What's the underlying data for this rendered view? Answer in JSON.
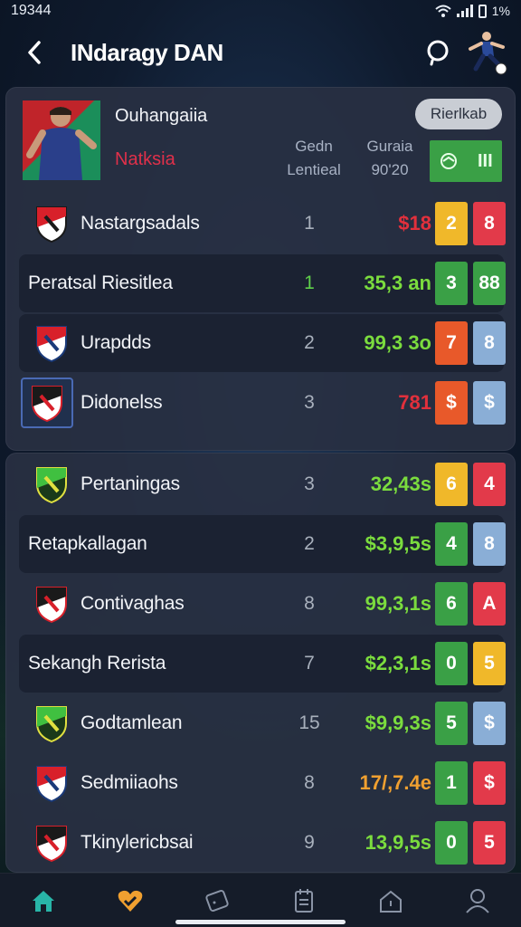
{
  "status_bar": {
    "time": "19344",
    "battery": "1%"
  },
  "header": {
    "title": "INdaragy DAN"
  },
  "profile": {
    "name": "Ouhangaiia",
    "subtitle": "Natksia",
    "col1_head": [
      "Gedn",
      "Lentieal"
    ],
    "col2_head": [
      "Guraia",
      "90'20"
    ],
    "action_button": "Rierlkab",
    "badge_text": "III"
  },
  "group1": [
    {
      "name": "Nastargsadals",
      "rank": "1",
      "score": "$18",
      "score_color": "red",
      "b1": "2",
      "b1_color": "yellow",
      "b2": "8",
      "b2_color": "red",
      "highlight": false,
      "crest": true
    },
    {
      "name": "Peratsal Riesitlea",
      "rank": "1",
      "score": "35,3 an",
      "score_color": "green",
      "rank_color": "green",
      "b1": "3",
      "b1_color": "green",
      "b2": "88",
      "b2_color": "green",
      "highlight": true,
      "crest": false
    },
    {
      "name": "Urapdds",
      "rank": "2",
      "score": "99,3 3o",
      "score_color": "green",
      "b1": "7",
      "b1_color": "orange",
      "b2": "8",
      "b2_color": "blue",
      "highlight": true,
      "crest": true
    },
    {
      "name": "Didonelss",
      "rank": "3",
      "score": "781",
      "score_color": "red",
      "b1": "$",
      "b1_color": "orange",
      "b2": "$",
      "b2_color": "blue",
      "highlight": false,
      "crest": true
    }
  ],
  "group2": [
    {
      "name": "Pertaningas",
      "rank": "3",
      "score": "32,43s",
      "score_color": "green",
      "b1": "6",
      "b1_color": "yellow",
      "b2": "4",
      "b2_color": "red",
      "highlight": false,
      "crest": true
    },
    {
      "name": "Retapkallagan",
      "rank": "2",
      "score": "$3,9,5s",
      "score_color": "green",
      "b1": "4",
      "b1_color": "green",
      "b2": "8",
      "b2_color": "blue",
      "highlight": true,
      "crest": false
    },
    {
      "name": "Contivaghas",
      "rank": "8",
      "score": "99,3,1s",
      "score_color": "green",
      "b1": "6",
      "b1_color": "green",
      "b2": "A",
      "b2_color": "red",
      "highlight": false,
      "crest": true
    },
    {
      "name": "Sekangh Rerista",
      "rank": "7",
      "score": "$2,3,1s",
      "score_color": "green",
      "b1": "0",
      "b1_color": "green",
      "b2": "5",
      "b2_color": "yellow",
      "highlight": true,
      "crest": false
    },
    {
      "name": "Godtamlean",
      "rank": "15",
      "score": "$9,9,3s",
      "score_color": "green",
      "b1": "5",
      "b1_color": "green",
      "b2": "$",
      "b2_color": "blue",
      "highlight": false,
      "crest": true
    },
    {
      "name": "Sedmiiaohs",
      "rank": "8",
      "score": "17/,7.4e",
      "score_color": "orange",
      "b1": "1",
      "b1_color": "green",
      "b2": "$",
      "b2_color": "red",
      "highlight": false,
      "crest": true
    },
    {
      "name": "Tkinylericbsai",
      "rank": "9",
      "score": "13,9,5s",
      "score_color": "green",
      "b1": "0",
      "b1_color": "green",
      "b2": "5",
      "b2_color": "red",
      "highlight": false,
      "crest": true
    }
  ],
  "nav": {
    "items": [
      {
        "icon": "home-icon",
        "color": "#28b5a8"
      },
      {
        "icon": "heart-check-icon",
        "color": "#f0a030"
      },
      {
        "icon": "ticket-icon",
        "color": "#8a94a6"
      },
      {
        "icon": "calendar-icon",
        "color": "#8a94a6"
      },
      {
        "icon": "house-outline-icon",
        "color": "#8a94a6"
      },
      {
        "icon": "profile-icon",
        "color": "#8a94a6"
      }
    ]
  }
}
